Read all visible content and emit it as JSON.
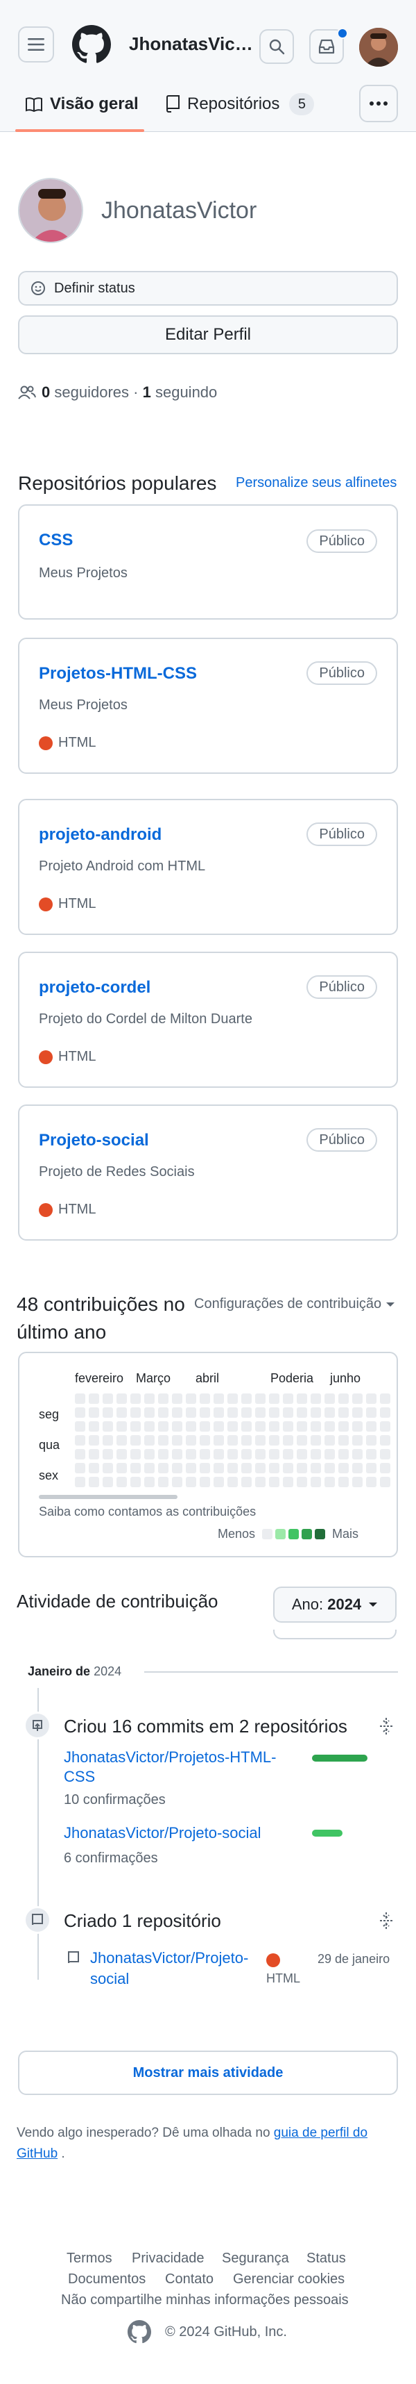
{
  "header": {
    "username": "JhonatasVic…",
    "menu_icon": "hamburger-icon",
    "search_icon": "search-icon",
    "inbox_icon": "inbox-icon"
  },
  "tabs": [
    {
      "label": "Visão geral",
      "icon": "book-icon",
      "active": true
    },
    {
      "label": "Repositórios",
      "icon": "repo-icon",
      "count": "5"
    }
  ],
  "profile": {
    "name": "JhonatasVictor",
    "status_label": "Definir status",
    "edit_label": "Editar Perfil",
    "followers_count": "0",
    "followers_label": "seguidores",
    "separator": "·",
    "following_count": "1",
    "following_label": "seguindo"
  },
  "popular": {
    "title": "Repositórios populares",
    "customize_label": "Personalize seus alfinetes",
    "repos": [
      {
        "name": "CSS",
        "description": "Meus Projetos",
        "visibility": "Público",
        "language": ""
      },
      {
        "name": "Projetos-HTML-CSS",
        "description": "Meus Projetos",
        "visibility": "Público",
        "language": "HTML"
      },
      {
        "name": "projeto-android",
        "description": "Projeto Android com HTML",
        "visibility": "Público",
        "language": "HTML"
      },
      {
        "name": "projeto-cordel",
        "description": "Projeto do Cordel de Milton Duarte",
        "visibility": "Público",
        "language": "HTML"
      },
      {
        "name": "Projeto-social",
        "description": "Projeto de Redes Sociais",
        "visibility": "Público",
        "language": "HTML"
      }
    ],
    "language_color": "#e34c26"
  },
  "contributions": {
    "title_line1": "48 contribuições no",
    "title_line2": "último ano",
    "settings_label": "Configurações de contribuição",
    "months": [
      "fevereiro",
      "Março",
      "abril",
      "Poderia",
      "junho"
    ],
    "days": [
      "seg",
      "qua",
      "sex"
    ],
    "how_label": "Saiba como contamos as contribuições",
    "less_label": "Menos",
    "more_label": "Mais",
    "legend_colors": [
      "#ebedf0",
      "#9be9a8",
      "#40c463",
      "#30a14e",
      "#216e39"
    ]
  },
  "activity": {
    "title": "Atividade de contribuição",
    "year_prefix": "Ano:",
    "year": "2024",
    "month_label": "Janeiro de",
    "month_year": "2024",
    "commits_title": "Criou 16 commits em 2 repositórios",
    "commit_repos": [
      {
        "name": "JhonatasVictor/Projetos-HTML-CSS",
        "count": "10 confirmações",
        "bar_fraction": 1.0
      },
      {
        "name": "JhonatasVictor/Projeto-social",
        "count": "6 confirmações",
        "bar_fraction": 0.55
      }
    ],
    "created_title": "Criado 1 repositório",
    "created_repo": "JhonatasVictor/Projeto-social",
    "created_lang": "HTML",
    "created_date": "29 de janeiro",
    "show_more_label": "Mostrar mais atividade"
  },
  "feedback": {
    "text": "Vendo algo inesperado? Dê uma olhada no",
    "link": "guia de perfil do GitHub",
    "end": "."
  },
  "footer": {
    "links_row1": [
      "Termos",
      "Privacidade",
      "Segurança",
      "Status"
    ],
    "links_row2": [
      "Documentos",
      "Contato",
      "Gerenciar cookies"
    ],
    "links_row3": "Não compartilhe minhas informações pessoais",
    "copyright": "© 2024 GitHub, Inc."
  }
}
